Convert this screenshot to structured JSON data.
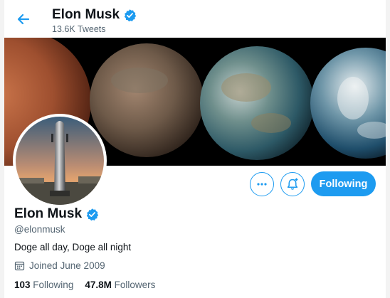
{
  "header": {
    "name": "Elon Musk",
    "tweet_count": "13.6K Tweets"
  },
  "profile": {
    "name": "Elon Musk",
    "handle": "@elonmusk",
    "bio": "Doge all day, Doge all night",
    "joined": "Joined June 2009",
    "following_count": "103",
    "following_label": "Following",
    "followers_count": "47.8M",
    "followers_label": "Followers"
  },
  "actions": {
    "follow_state_label": "Following"
  },
  "icons": {
    "back": "arrow-left-icon",
    "verified": "verified-badge-icon",
    "more": "more-dots-icon",
    "notify": "bell-plus-icon",
    "calendar": "calendar-icon"
  },
  "colors": {
    "accent": "#1d9bf0",
    "secondary_text": "#536471"
  }
}
